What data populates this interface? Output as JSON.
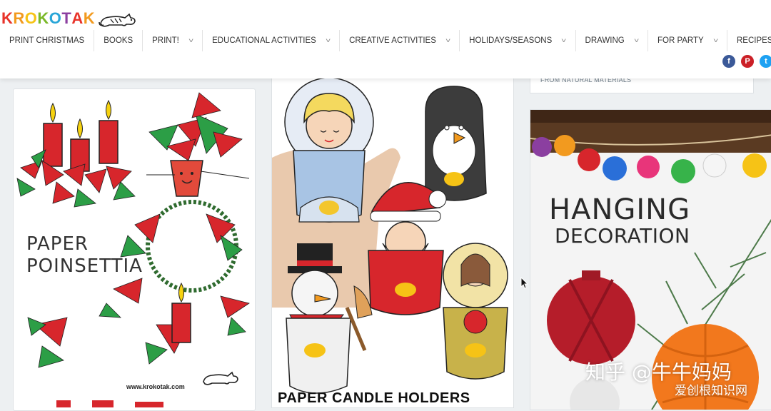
{
  "logo": {
    "letters": [
      "K",
      "R",
      "O",
      "K",
      "O",
      "T",
      "A",
      "K"
    ],
    "letter_colors": [
      "#e8332a",
      "#f29a1f",
      "#f6c316",
      "#7ab828",
      "#2aa6d8",
      "#8b3fa0",
      "#e8332a",
      "#f29a1f"
    ]
  },
  "nav": {
    "items": [
      {
        "label": "PRINT CHRISTMAS",
        "dropdown": false
      },
      {
        "label": "BOOKS",
        "dropdown": false
      },
      {
        "label": "PRINT!",
        "dropdown": true
      },
      {
        "label": "EDUCATIONAL ACTIVITIES",
        "dropdown": true
      },
      {
        "label": "CREATIVE ACTIVITIES",
        "dropdown": true
      },
      {
        "label": "HOLIDAYS/SEASONS",
        "dropdown": true
      },
      {
        "label": "DRAWING",
        "dropdown": true
      },
      {
        "label": "FOR PARTY",
        "dropdown": true
      },
      {
        "label": "RECIPES",
        "dropdown": true
      }
    ],
    "chevron": "˅",
    "language_flag": "bulgarian-flag-icon"
  },
  "socials": [
    {
      "icon": "facebook-icon",
      "glyph": "f",
      "color": "#3b5998"
    },
    {
      "icon": "pinterest-icon",
      "glyph": "P",
      "color": "#cb2027"
    },
    {
      "icon": "twitter-icon",
      "glyph": "t",
      "color": "#1da1f2"
    }
  ],
  "snippet": {
    "text": "FROM NATURAL MATERIALS"
  },
  "cards": {
    "poinsettia": {
      "title_line1": "PAPER",
      "title_line2": "POINSETTIA",
      "url": "www.krokotak.com"
    },
    "candle_holders": {
      "title": "PAPER CANDLE HOLDERS"
    },
    "hanging": {
      "title_line1": "HANGING",
      "title_line2": "DECORATION"
    }
  },
  "watermark": {
    "text": "知乎 @牛牛妈妈",
    "site": "爱创根知识网"
  },
  "colors": {
    "accent_red": "#d7262c",
    "green": "#2c9e46",
    "brand_orange": "#f29a1f"
  }
}
